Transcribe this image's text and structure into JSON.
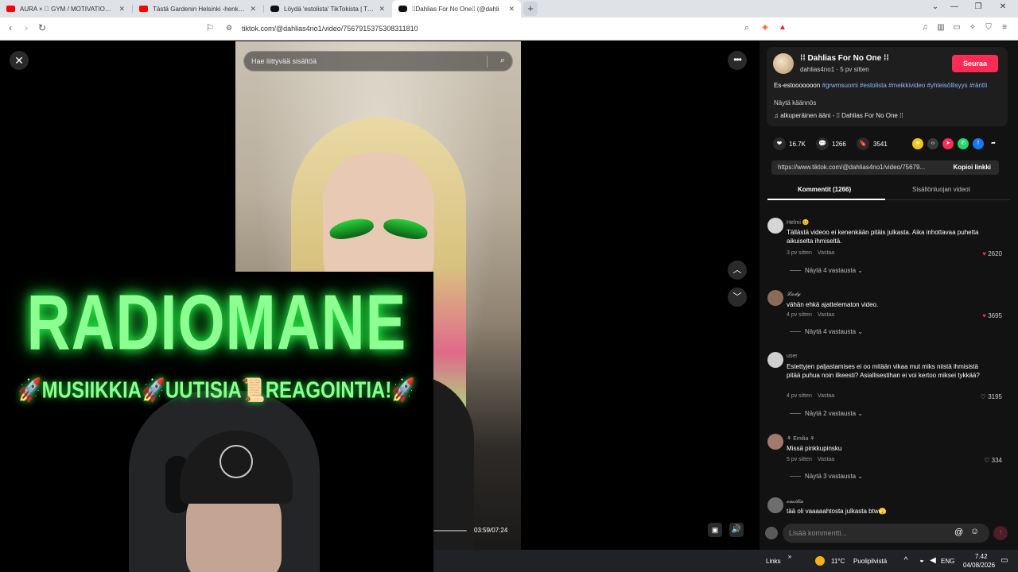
{
  "browser": {
    "tabs": [
      {
        "title": "AURA × 🏻 GYM / MOTIVATION × Eur",
        "favicon": "youtube-icon",
        "active": false
      },
      {
        "title": "Tästä Gardenin Helsinki -henkilöseen on",
        "favicon": "youtube-icon",
        "active": false
      },
      {
        "title": "Löydä 'estolista' TikTokista | TikTok-h",
        "favicon": "tiktok-icon",
        "active": false
      },
      {
        "title": "⁞⁞Dahlias For No One⁞⁞ (@dahli",
        "favicon": "tiktok-icon",
        "active": true
      }
    ],
    "new_tab": "+",
    "url": "tiktok.com/@dahlias4no1/video/7567915375308311810"
  },
  "video": {
    "search_placeholder": "Hae liittyvää sisältöä",
    "time": "03:59/07:24",
    "progress": 0.54
  },
  "panel": {
    "author": {
      "name": "⁞⁞ Dahlias For No One ⁞⁞",
      "meta": "dahlias4no1 · 5 pv sitten",
      "follow": "Seuraa"
    },
    "desc_plain": "Es-estooooooon",
    "desc_tags": " #grwmsuomi #estolista #meikkivideo #yhteisöllisyys #räntti",
    "see_translation": "Näytä käännös",
    "music": "♫  alkuperäinen ääni - ⁞⁞ Dahlias For No One ⁞⁞",
    "likes": "16.7K",
    "comments": "1266",
    "saves": "3541",
    "share_icons": [
      "coin-icon",
      "embed-icon",
      "friends-icon",
      "whatsapp-icon",
      "facebook-icon",
      "share-arrow-icon"
    ],
    "copy_url": "https://www.tiktok.com/@dahlias4no1/video/75679...",
    "copy_label": "Kopioi linkki",
    "tab_comments": "Kommentit (1266)",
    "tab_creator": "Sisällönluojan videot",
    "comments_list": [
      {
        "user": "Helmi 😊",
        "text": "Tällästä videoo ei kenenkään pitäis julkasta. Aika inhottavaa puhetta aikuiselta ihmiseltä.",
        "age": "3 pv sitten",
        "reply": "Vastaa",
        "likes": "2620",
        "liked": true,
        "more": "Näytä 4 vastausta"
      },
      {
        "user": "𝓛𝓪𝓭𝔂",
        "text": "vähän ehkä ajattelematon video.",
        "age": "4 pv sitten",
        "reply": "Vastaa",
        "likes": "3695",
        "liked": true,
        "more": "Näytä 4 vastausta"
      },
      {
        "user": "user",
        "text": "Estettyjen paljastamises ei oo mitään vikaa mut miks niistä ihmisistä pitää puhua noin ilkeesti? Asiallisestihan ei voi kertoo miksei tykkää?",
        "age": "4 pv sitten",
        "reply": "Vastaa",
        "likes": "3195",
        "liked": false,
        "more": "Näytä 2 vastausta"
      },
      {
        "user": "⚘ Emilia ⚘",
        "text": "Missä pinkkupinsku",
        "age": "5 pv sitten",
        "reply": "Vastaa",
        "likes": "334",
        "liked": false,
        "more": "Näytä 3 vastausta"
      },
      {
        "user": "𝓮𝓶𝓲𝓵𝓲𝓪",
        "text": "tää oli vaaaaahtosta julkasta btw🫣",
        "age": "",
        "reply": "",
        "likes": "",
        "liked": false,
        "more": ""
      }
    ],
    "comment_placeholder": "Lisää kommentti..."
  },
  "overlay": {
    "title": "RADIOMANE",
    "subtitle": "🚀MUSIIKKIA🚀UUTISIA📜REAGOINTIA!🚀"
  },
  "taskbar": {
    "links": "Links",
    "temp": "11°C",
    "weather": "Puolipilvistä",
    "lang": "ENG",
    "time": "7.42",
    "date": "04/08/2026"
  },
  "colors": {
    "accent": "#fe2c55",
    "neon": "#8dff92",
    "panel": "#121212"
  }
}
